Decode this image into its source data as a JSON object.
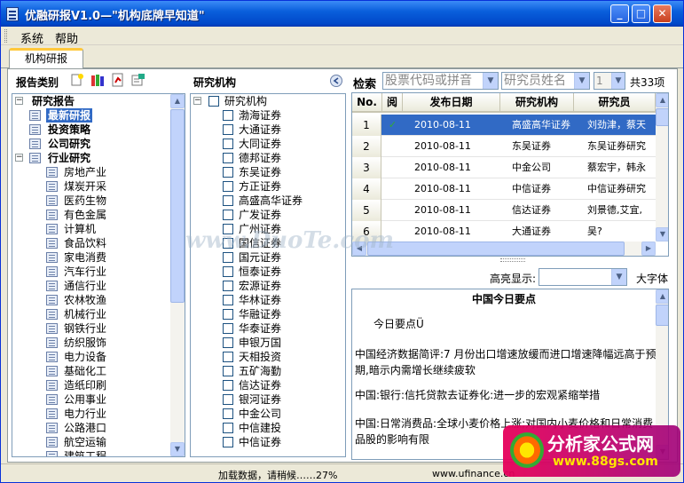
{
  "window": {
    "title": "优融研报V1.0—\"机构底牌早知道\""
  },
  "menu": [
    "系统",
    "帮助"
  ],
  "tab": {
    "label": "机构研报"
  },
  "left_panel": {
    "header": "报告类别",
    "icons": [
      "new-doc-icon",
      "books-icon",
      "report-icon",
      "export-icon"
    ],
    "root": "研究报告",
    "top_items": [
      {
        "label": "最新研报",
        "selected": true
      },
      {
        "label": "投资策略"
      },
      {
        "label": "公司研究"
      },
      {
        "label": "行业研究"
      }
    ],
    "industries": [
      "房地产业",
      "煤炭开采",
      "医药生物",
      "有色金属",
      "计算机",
      "食品饮料",
      "家电消费",
      "汽车行业",
      "通信行业",
      "农林牧渔",
      "机械行业",
      "钢铁行业",
      "纺织服饰",
      "电力设备",
      "基础化工",
      "造纸印刷",
      "公用事业",
      "电力行业",
      "公路港口",
      "航空运输",
      "建筑工程"
    ]
  },
  "mid_panel": {
    "header": "研究机构",
    "root": "研究机构",
    "items": [
      "渤海证券",
      "大通证券",
      "大同证券",
      "德邦证券",
      "东吴证券",
      "方正证券",
      "高盛高华证券",
      "广发证券",
      "广州证券",
      "国信证券",
      "国元证券",
      "恒泰证券",
      "宏源证券",
      "华林证券",
      "华融证券",
      "华泰证券",
      "申银万国",
      "天相投资",
      "五矿海勤",
      "信达证券",
      "银河证券",
      "中金公司",
      "中信建投",
      "中信证券"
    ]
  },
  "search": {
    "label": "检索",
    "code_placeholder": "股票代码或拼音",
    "analyst_placeholder": "研究员姓名",
    "page": "1",
    "total": "共33项"
  },
  "grid": {
    "columns": [
      "No.",
      "阅",
      "发布日期",
      "研究机构",
      "研究员"
    ],
    "rows": [
      {
        "no": "1",
        "read": "✓",
        "date": "2010-08-11",
        "org": "高盛高华证券",
        "analyst": "刘劲津，蔡天"
      },
      {
        "no": "2",
        "read": "",
        "date": "2010-08-11",
        "org": "东吴证券",
        "analyst": "东吴证券研究"
      },
      {
        "no": "3",
        "read": "",
        "date": "2010-08-11",
        "org": "中金公司",
        "analyst": "蔡宏宇，韩永"
      },
      {
        "no": "4",
        "read": "",
        "date": "2010-08-11",
        "org": "中信证券",
        "analyst": "中信证券研究"
      },
      {
        "no": "5",
        "read": "",
        "date": "2010-08-11",
        "org": "信达证券",
        "analyst": "刘景德,艾宜,"
      },
      {
        "no": "6",
        "read": "",
        "date": "2010-08-11",
        "org": "大通证券",
        "analyst": "吴?"
      }
    ]
  },
  "highlight": {
    "label": "高亮显示:",
    "big_font": "大字体"
  },
  "news": {
    "title": "中国今日要点",
    "lines": [
      "今日要点Ü",
      "中国经济数据简评:7 月份出口增速放缓而进口增速降幅远高于预期,暗示内需增长继续疲软",
      "中国:银行:信托贷款去证券化:进一步的宏观紧缩举措",
      "中国:日常消费品:全球小麦价格上涨;对国内小麦价格和日常消费品股的影响有限"
    ]
  },
  "status": {
    "loading": "加载数据，请稍候……27%",
    "url": "www.ufinance.cn"
  },
  "watermarks": {
    "center": "www.DuoTe.com",
    "badge_title": "分析家公式网",
    "badge_url": "www.88gs.com"
  }
}
